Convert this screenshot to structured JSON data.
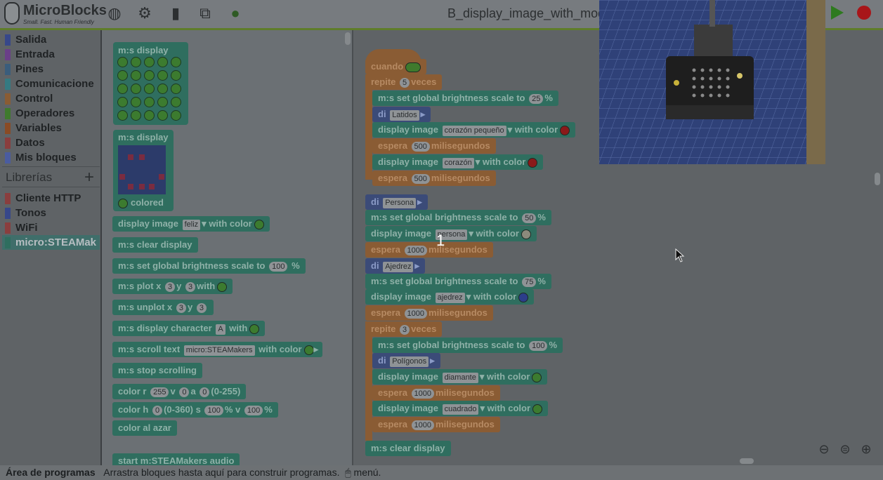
{
  "app": {
    "name": "MicroBlocks",
    "tagline": "Small. Fast. Human Friendly",
    "title": "B_display_image_with_modi"
  },
  "toolbar": {
    "icons": [
      "globe-icon",
      "gear-icon",
      "file-icon",
      "graph-icon",
      "board-icon"
    ]
  },
  "categories": [
    {
      "label": "Salida",
      "color": "#37478a"
    },
    {
      "label": "Entrada",
      "color": "#6a3f88"
    },
    {
      "label": "Pines",
      "color": "#3a5d7c"
    },
    {
      "label": "Comunicacione",
      "color": "#357a82"
    },
    {
      "label": "Control",
      "color": "#8a5c34"
    },
    {
      "label": "Operadores",
      "color": "#3f7a2d"
    },
    {
      "label": "Variables",
      "color": "#8a4b25"
    },
    {
      "label": "Datos",
      "color": "#8a3e3e"
    },
    {
      "label": "Mis bloques",
      "color": "#4a5ca0"
    }
  ],
  "libraries": {
    "header": "Librerías",
    "plus": "+",
    "items": [
      {
        "label": "Cliente HTTP",
        "color": "#8a3e3e"
      },
      {
        "label": "Tonos",
        "color": "#37478a"
      },
      {
        "label": "WiFi",
        "color": "#8a3e3e"
      },
      {
        "label": "micro:STEAMak",
        "color": "#2f6e5f"
      }
    ]
  },
  "palette": {
    "display1": "m:s display",
    "display2": "m:s display",
    "colored": "colored",
    "display_image": "display image",
    "feliz": "feliz",
    "with_color": "with color",
    "clear": "m:s clear display",
    "brightness": "m:s set global brightness scale to",
    "b100": "100",
    "pct": "%",
    "plot": "m:s plot x",
    "p3": "3",
    "y": "y",
    "with": "with",
    "unplot": "m:s unplot x",
    "dchar": "m:s display character",
    "A": "A",
    "scroll": "m:s scroll text",
    "scrolltxt": "micro:STEAMakers",
    "stop": "m:s stop scrolling",
    "color_r": "color r",
    "c255": "255",
    "v": "v",
    "c0": "0",
    "a": "a",
    "r255": "(0-255)",
    "color_h": "color h",
    "h0": "0",
    "h360": "(0-360) s",
    "s100": "100",
    "pctv": "% v",
    "azar": "color al azar",
    "audio": "start m:STEAMakers audio"
  },
  "script": {
    "cuando": "cuando",
    "repite": "repite",
    "r5": "5",
    "veces": "veces",
    "bright": "m:s set global brightness scale to",
    "v25": "25",
    "v50": "50",
    "v75": "75",
    "v100": "100",
    "pct": "%",
    "di": "di",
    "latidos": "Latidos",
    "persona": "Persona",
    "ajedrez": "Ajedrez",
    "poligonos": "Polígonos",
    "display_image": "display image",
    "with_color": "with color",
    "corazon_peq": "corazón pequeño",
    "corazon": "corazón",
    "persona_img": "persona",
    "ajedrez_img": "ajedrez",
    "diamante": "diamante",
    "cuadrado": "cuadrado",
    "espera": "espera",
    "ms": "milisegundos",
    "e500": "500",
    "e1000": "1000",
    "r3": "3",
    "clear": "m:s clear display",
    "counter": "1"
  },
  "status": {
    "title": "Área de programas",
    "hint": "Arrastra bloques hasta aquí para construir programas.",
    "menu": "menú."
  }
}
